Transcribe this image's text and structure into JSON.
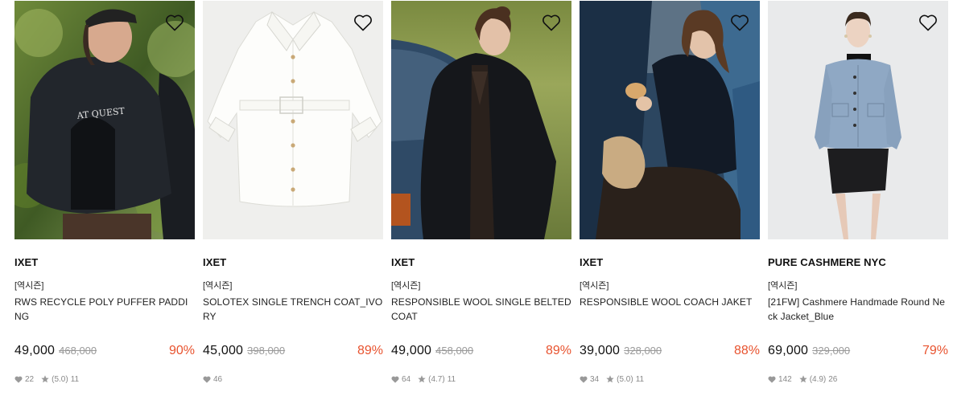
{
  "products": [
    {
      "brand": "IXET",
      "tag": "[역시즌]",
      "name": "RWS RECYCLE POLY PUFFER PADDING",
      "price": "49,000",
      "original_price": "468,000",
      "discount": "90%",
      "likes": "22",
      "rating": "(5.0)",
      "reviews": "11",
      "image": "model-in-black-puffer-jacket-and-cap-outdoors"
    },
    {
      "brand": "IXET",
      "tag": "[역시즌]",
      "name": "SOLOTEX SINGLE TRENCH COAT_IVORY",
      "price": "45,000",
      "original_price": "398,000",
      "discount": "89%",
      "likes": "46",
      "rating": "",
      "reviews": "",
      "image": "ivory-trench-coat-flat-lay"
    },
    {
      "brand": "IXET",
      "tag": "[역시즌]",
      "name": "RESPONSIBLE WOOL SINGLE BELTED COAT",
      "price": "49,000",
      "original_price": "458,000",
      "discount": "89%",
      "likes": "64",
      "rating": "(4.7)",
      "reviews": "11",
      "image": "model-in-black-wool-coat-by-car"
    },
    {
      "brand": "IXET",
      "tag": "[역시즌]",
      "name": "RESPONSIBLE WOOL COACH JAKET",
      "price": "39,000",
      "original_price": "328,000",
      "discount": "88%",
      "likes": "34",
      "rating": "(5.0)",
      "reviews": "11",
      "image": "model-in-navy-jacket-sitting-in-car"
    },
    {
      "brand": "PURE CASHMERE NYC",
      "tag": "[역시즌]",
      "name": "[21FW] Cashmere Handmade Round Neck Jacket_Blue",
      "price": "69,000",
      "original_price": "329,000",
      "discount": "79%",
      "likes": "142",
      "rating": "(4.9)",
      "reviews": "26",
      "image": "model-in-blue-cashmere-jacket-and-black-skirt"
    }
  ],
  "colors": {
    "discount": "#e8532f",
    "price": "#111111",
    "original_price": "#9a9a9a",
    "meta": "#888888"
  },
  "icons": {
    "wishlist": "heart-outline-icon",
    "likes": "heart-filled-icon",
    "rating": "star-icon"
  }
}
